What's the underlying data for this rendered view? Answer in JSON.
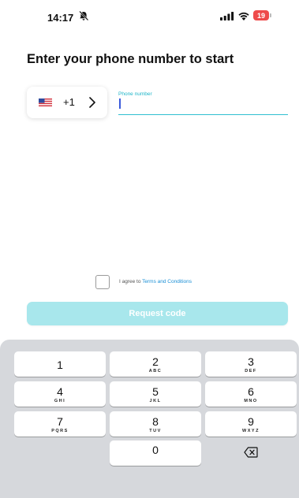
{
  "status_bar": {
    "time": "14:17",
    "battery_level": "19",
    "icons": [
      "bell-slash-icon",
      "signal-icon",
      "wifi-icon",
      "battery-icon"
    ]
  },
  "title": "Enter your phone number to start",
  "country_picker": {
    "flag": "us-flag-icon",
    "dial_code": "+1",
    "chevron": "chevron-right-icon"
  },
  "phone_field": {
    "label": "Phone number",
    "value": ""
  },
  "agreement": {
    "prefix": "I agree to ",
    "link": "Terms and Conditions",
    "checked": false
  },
  "request_button": {
    "label": "Request code"
  },
  "keypad": {
    "keys": [
      {
        "digit": "1",
        "letters": ""
      },
      {
        "digit": "2",
        "letters": "ABC"
      },
      {
        "digit": "3",
        "letters": "DEF"
      },
      {
        "digit": "4",
        "letters": "GHI"
      },
      {
        "digit": "5",
        "letters": "JKL"
      },
      {
        "digit": "6",
        "letters": "MNO"
      },
      {
        "digit": "7",
        "letters": "PQRS"
      },
      {
        "digit": "8",
        "letters": "TUV"
      },
      {
        "digit": "9",
        "letters": "WXYZ"
      },
      {
        "digit": "0",
        "letters": ""
      }
    ],
    "delete_icon": "backspace-icon"
  },
  "colors": {
    "accent": "#2fbfd1",
    "link": "#1a8fd6",
    "button_disabled": "#a8e7ec",
    "battery": "#ee4b4b",
    "keyboard_bg": "#d6d8dc"
  }
}
